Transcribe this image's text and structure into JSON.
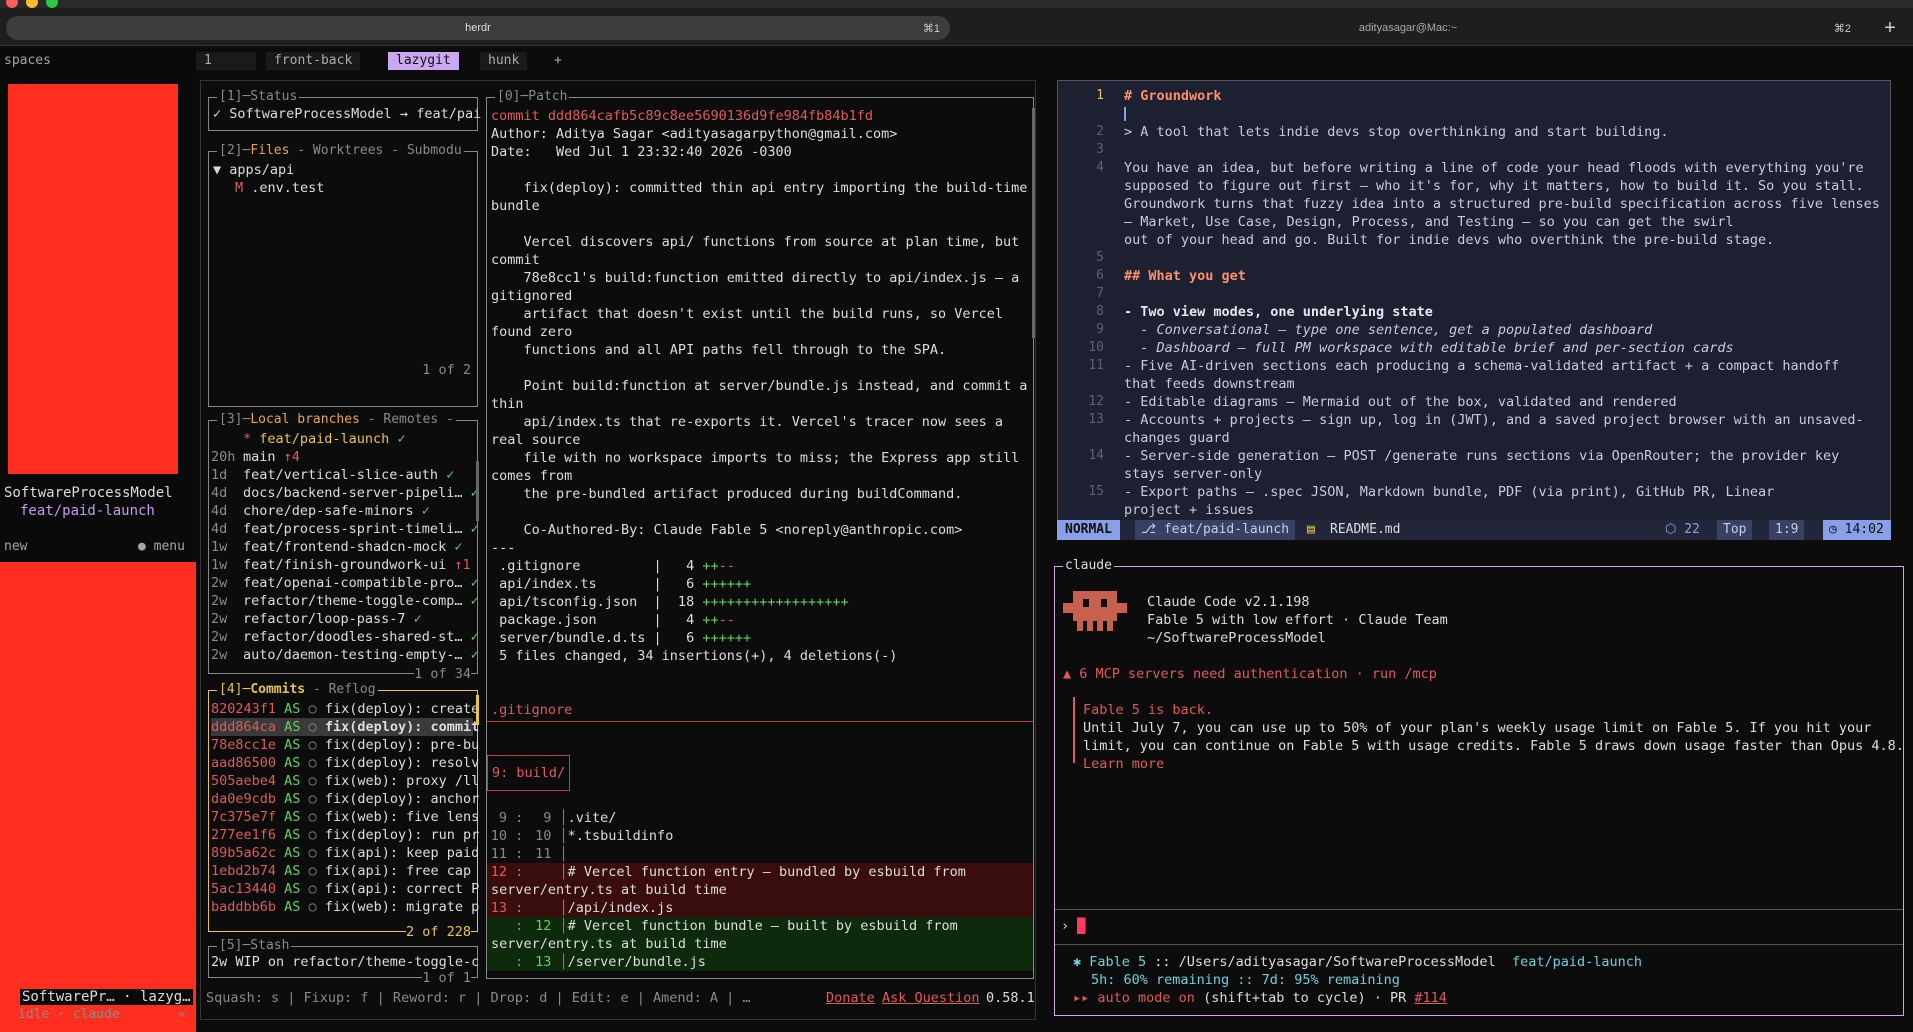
{
  "window": {
    "app_name": "herdr",
    "tabs": [
      {
        "label": "herdr",
        "shortcut": "⌘1"
      },
      {
        "label": "adityasagar@Mac:~",
        "shortcut": "⌘2"
      }
    ],
    "add": "+"
  },
  "sidebar": {
    "spaces_label": "spaces",
    "space1_name": "SoftwareProcessModel",
    "space1_branch": "feat/paid-launch",
    "new_label": "new",
    "menu_label": "menu",
    "bottom_name": "SoftwarePr… · lazyg…",
    "bottom_status": "idle · claude",
    "collapse": "«"
  },
  "pane_tabs": {
    "num": "1",
    "items": [
      "front-back",
      "lazygit",
      "hunk"
    ],
    "add": "+"
  },
  "lazygit": {
    "status_title": "[1]─Status",
    "status_text": "✓ SoftwareProcessModel → feat/pai",
    "files_title_num": "[2]─",
    "files_title": "Files",
    "files_rest": " - Worktrees - Submodu",
    "files_dir": "▼ apps/api",
    "files_mark": "M",
    "files_file": ".env.test",
    "files_count": "1 of 2",
    "branches_title_num": "[3]─",
    "branches_title": "Local branches",
    "branches_rest": " - Remotes -",
    "branches": [
      {
        "age": "",
        "star": "*",
        "name": "feat/paid-launch",
        "mark": "✓"
      },
      {
        "age": "20h",
        "star": "",
        "name": "main",
        "mark": "↑4"
      },
      {
        "age": "1d",
        "star": "",
        "name": "feat/vertical-slice-auth",
        "mark": "✓"
      },
      {
        "age": "4d",
        "star": "",
        "name": "docs/backend-server-pipeli…",
        "mark": "✓"
      },
      {
        "age": "4d",
        "star": "",
        "name": "chore/dep-safe-minors",
        "mark": "✓"
      },
      {
        "age": "4d",
        "star": "",
        "name": "feat/process-sprint-timeli…",
        "mark": "✓"
      },
      {
        "age": "1w",
        "star": "",
        "name": "feat/frontend-shadcn-mock",
        "mark": "✓"
      },
      {
        "age": "1w",
        "star": "",
        "name": "feat/finish-groundwork-ui",
        "mark": "↑1"
      },
      {
        "age": "2w",
        "star": "",
        "name": "feat/openai-compatible-pro…",
        "mark": "✓"
      },
      {
        "age": "2w",
        "star": "",
        "name": "refactor/theme-toggle-comp…",
        "mark": "✓"
      },
      {
        "age": "2w",
        "star": "",
        "name": "refactor/loop-pass-7",
        "mark": "✓"
      },
      {
        "age": "2w",
        "star": "",
        "name": "refactor/doodles-shared-st…",
        "mark": "✓"
      },
      {
        "age": "2w",
        "star": "",
        "name": "auto/daemon-testing-empty-…",
        "mark": "✓"
      }
    ],
    "branches_count": "1 of 34",
    "commits_title_num": "[4]─",
    "commits_title": "Commits",
    "commits_rest": " - Reflog",
    "commits": [
      {
        "hash": "820243f1",
        "au": "AS",
        "msg": "fix(deploy): create"
      },
      {
        "hash": "ddd864ca",
        "au": "AS",
        "msg": "fix(deploy): commit"
      },
      {
        "hash": "78e8cc1e",
        "au": "AS",
        "msg": "fix(deploy): pre-bu"
      },
      {
        "hash": "aad86500",
        "au": "AS",
        "msg": "fix(deploy): resolv"
      },
      {
        "hash": "505aebe4",
        "au": "AS",
        "msg": "fix(web): proxy /ll"
      },
      {
        "hash": "da0e9cdb",
        "au": "AS",
        "msg": "fix(deploy): anchor"
      },
      {
        "hash": "7c375e7f",
        "au": "AS",
        "msg": "fix(web): five lens"
      },
      {
        "hash": "277ee1f6",
        "au": "AS",
        "msg": "fix(deploy): run pr"
      },
      {
        "hash": "89b5a62c",
        "au": "AS",
        "msg": "fix(api): keep paid"
      },
      {
        "hash": "1ebd2b74",
        "au": "AS",
        "msg": "fix(api): free cap "
      },
      {
        "hash": "5ac13440",
        "au": "AS",
        "msg": "fix(api): correct P"
      },
      {
        "hash": "baddbb6b",
        "au": "AS",
        "msg": "fix(web): migrate p"
      }
    ],
    "commits_count": "2 of 228",
    "stash_title": "[5]─Stash",
    "stash_item": "2w WIP on refactor/theme-toggle-c",
    "stash_count": "1 of 1",
    "patch_title": "[0]─Patch",
    "patch_lines": [
      "commit ddd864cafb5c89c8ee5690136d9fe984fb84b1fd",
      "Author: Aditya Sagar <adityasagarpython@gmail.com>",
      "Date:   Wed Jul 1 23:32:40 2026 -0300",
      "",
      "    fix(deploy): committed thin api entry importing the build-time",
      "bundle",
      "",
      "    Vercel discovers api/ functions from source at plan time, but",
      "commit",
      "    78e8cc1's build:function emitted directly to api/index.js — a",
      "gitignored",
      "    artifact that doesn't exist until the build runs, so Vercel",
      "found zero",
      "    functions and all API paths fell through to the SPA.",
      "",
      "    Point build:function at server/bundle.js instead, and commit a",
      "thin",
      "    api/index.ts that re-exports it. Vercel's tracer now sees a",
      "real source",
      "    file with no workspace imports to miss; the Express app still",
      "comes from",
      "    the pre-bundled artifact produced during buildCommand.",
      "",
      "    Co-Authored-By: Claude Fable 5 <noreply@anthropic.com>",
      "---"
    ],
    "stats": [
      {
        "file": " .gitignore        ",
        "n": "  4",
        "bar": "++--"
      },
      {
        "file": " api/index.ts      ",
        "n": "  6",
        "bar": "++++++"
      },
      {
        "file": " api/tsconfig.json ",
        "n": " 18",
        "bar": "++++++++++++++++++"
      },
      {
        "file": " package.json      ",
        "n": "  4",
        "bar": "++--"
      },
      {
        "file": " server/bundle.d.ts",
        "n": "  6",
        "bar": "++++++"
      }
    ],
    "stats_summary": " 5 files changed, 34 insertions(+), 4 deletions(-)",
    "diff_file": ".gitignore",
    "hunk_header": "9: build/",
    "diff_lines": [
      {
        "a": " 9",
        "b": " 9",
        "t": ".vite/",
        "k": "ctx"
      },
      {
        "a": "10",
        "b": "10",
        "t": "*.tsbuildinfo",
        "k": "ctx"
      },
      {
        "a": "11",
        "b": "11",
        "t": "",
        "k": "ctx"
      },
      {
        "a": "12",
        "b": "  ",
        "t": "# Vercel function entry — bundled by esbuild from",
        "k": "del"
      },
      {
        "a": "",
        "b": "",
        "t": "server/entry.ts at build time",
        "k": "delwrap"
      },
      {
        "a": "13",
        "b": "  ",
        "t": "/api/index.js",
        "k": "del"
      },
      {
        "a": "  ",
        "b": "12",
        "t": "# Vercel function bundle — built by esbuild from",
        "k": "add"
      },
      {
        "a": "",
        "b": "",
        "t": "server/entry.ts at build time",
        "k": "addwrap"
      },
      {
        "a": "  ",
        "b": "13",
        "t": "/server/bundle.js",
        "k": "add"
      }
    ],
    "footer_keys": "Squash: s | Fixup: f | Reword: r | Drop: d | Edit: e | Amend: A | …",
    "donate": "Donate",
    "ask": "Ask Question",
    "version": "0.58.1"
  },
  "editor": {
    "mode": "NORMAL",
    "branch": "feat/paid-launch",
    "file": "README.md",
    "count": "22",
    "pos": "Top",
    "cursor": "1:9",
    "time": "14:02",
    "lines": [
      {
        "n": "1",
        "t": "# Groundwork",
        "k": "h1"
      },
      {
        "n": "",
        "t": "",
        "k": "cursor"
      },
      {
        "n": "2",
        "t": "> A tool that lets indie devs stop overthinking and start building.",
        "k": "quote"
      },
      {
        "n": "3",
        "t": "",
        "k": ""
      },
      {
        "n": "4",
        "t": "You have an idea, but before writing a line of code your head floods with everything you're",
        "k": ""
      },
      {
        "n": "",
        "t": "supposed to figure out first — who it's for, why it matters, how to build it. So you stall.",
        "k": "ital1"
      },
      {
        "n": "",
        "t": "Groundwork turns that fuzzy idea into a structured pre-build specification across five lenses",
        "k": ""
      },
      {
        "n": "",
        "t": "— Market, Use Case, Design, Process, and Testing — so you can get the swirl",
        "k": ""
      },
      {
        "n": "",
        "t": "out of your head and go. Built for indie devs who overthink the pre-build stage.",
        "k": ""
      },
      {
        "n": "5",
        "t": "",
        "k": ""
      },
      {
        "n": "6",
        "t": "## What you get",
        "k": "h2"
      },
      {
        "n": "7",
        "t": "",
        "k": ""
      },
      {
        "n": "8",
        "t": "- Two view modes, one underlying state",
        "k": "bullet-bold"
      },
      {
        "n": "9",
        "t": "  - Conversational — type one sentence, get a populated dashboard",
        "k": "sub"
      },
      {
        "n": "10",
        "t": "  - Dashboard — full PM workspace with editable brief and per-section cards",
        "k": "sub"
      },
      {
        "n": "11",
        "t": "- Five AI-driven sections each producing a schema-validated artifact + a compact handoff",
        "k": "bullet"
      },
      {
        "n": "",
        "t": "that feeds downstream",
        "k": ""
      },
      {
        "n": "12",
        "t": "- Editable diagrams — Mermaid out of the box, validated and rendered",
        "k": "bullet"
      },
      {
        "n": "13",
        "t": "- Accounts + projects — sign up, log in (JWT), and a saved project browser with an unsaved-",
        "k": "bullet"
      },
      {
        "n": "",
        "t": "changes guard",
        "k": ""
      },
      {
        "n": "14",
        "t": "- Server-side generation — POST /generate runs sections via OpenRouter; the provider key",
        "k": "bullet"
      },
      {
        "n": "",
        "t": "stays server-only",
        "k": ""
      },
      {
        "n": "15",
        "t": "- Export paths — .spec JSON, Markdown bundle, PDF (via print), GitHub PR, Linear",
        "k": "bullet"
      },
      {
        "n": "",
        "t": "project + issues",
        "k": ""
      }
    ]
  },
  "claude": {
    "title": "claude",
    "version": "Claude Code v2.1.198",
    "model": "Fable 5 with low effort · Claude Team",
    "path": "~/SoftwareProcessModel",
    "warn": "▲ 6 MCP servers need authentication · run /mcp",
    "notice_title": "Fable 5 is back.",
    "notice_body1": "Until July 7, you can use up to 50% of your plan's weekly usage limit on Fable 5. If you hit your",
    "notice_body2": "limit, you can continue on Fable 5 with usage credits. Fable 5 draws down usage faster than Opus 4.8.",
    "notice_link": "Learn more",
    "prompt": "›",
    "status_model": "✱ Fable 5",
    "status_path": ":: /Users/adityasagar/SoftwareProcessModel",
    "status_branch": "feat/paid-launch",
    "usage": "5h: 60% remaining :: 7d: 95% remaining",
    "auto_mode": "▸▸ auto mode on",
    "auto_hint": "(shift+tab to cycle) · PR",
    "pr": "#114"
  },
  "colors": {
    "accent": "#c9a8f0",
    "red_block": "#ff2e1f",
    "commit_hash": "#e05a5a",
    "branch_active": "#e8c547"
  }
}
